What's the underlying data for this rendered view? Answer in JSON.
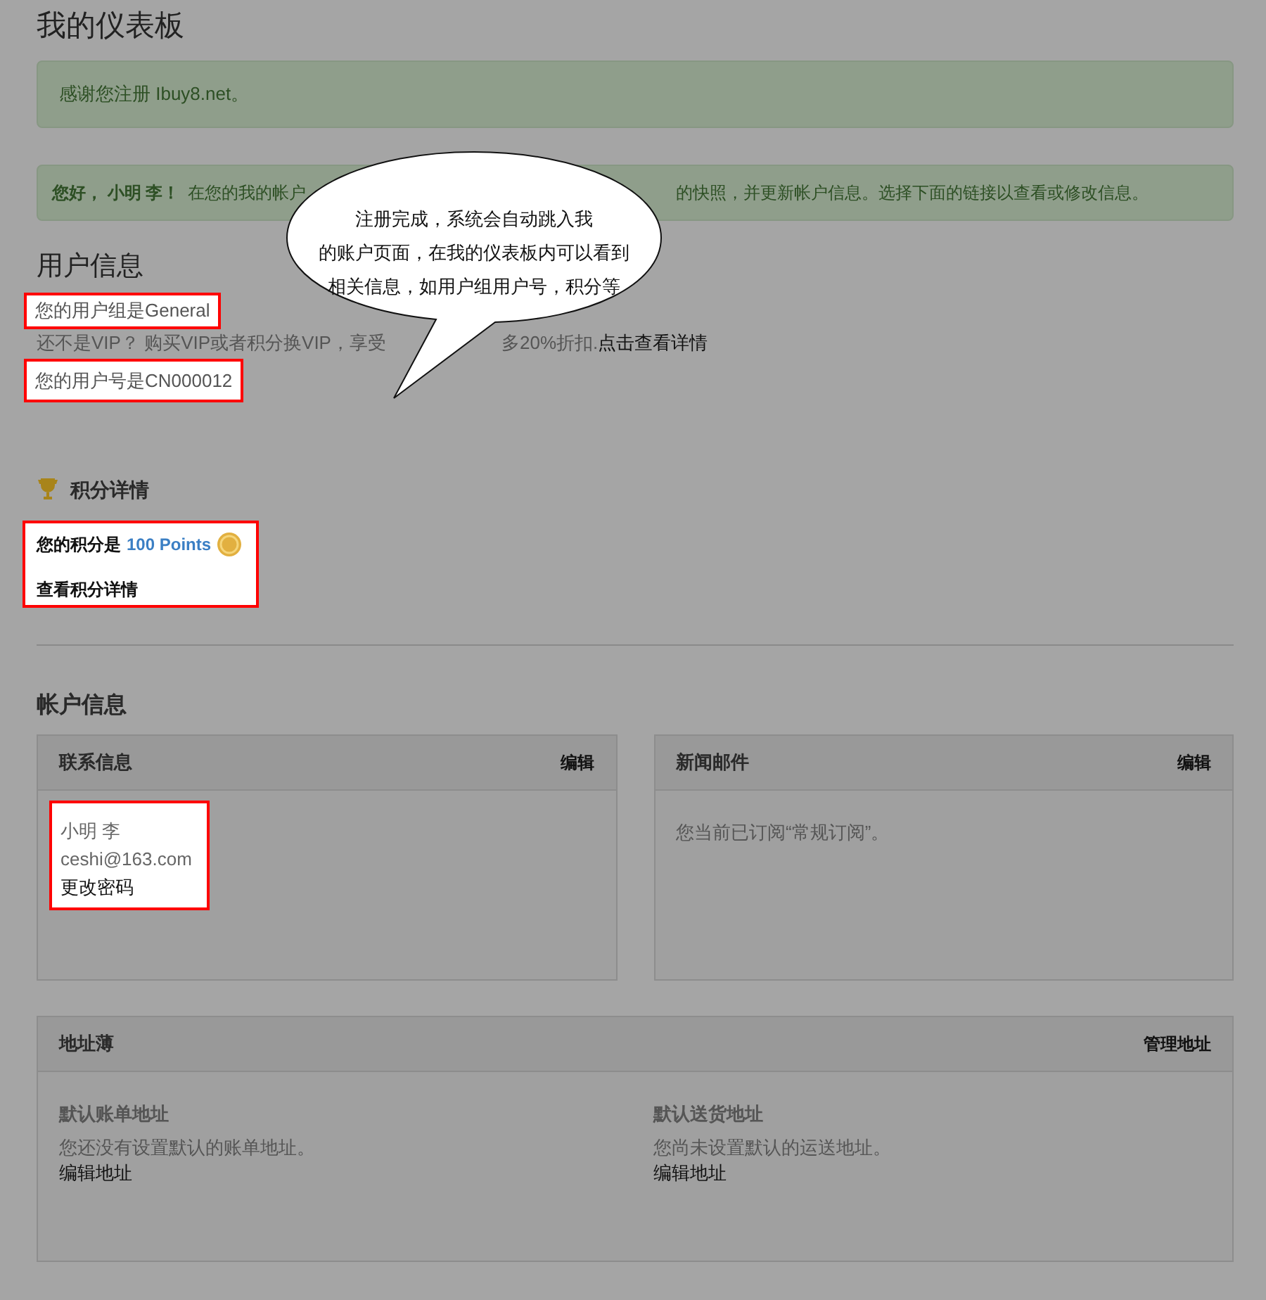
{
  "page_title": "我的仪表板",
  "notice": "感谢您注册 Ibuy8.net。",
  "welcome": {
    "greeting": "您好， 小明 李！",
    "text_before": "在您的我的帐户",
    "text_after": "的快照，并更新帐户信息。选择下面的链接以查看或修改信息。"
  },
  "callout": {
    "lines": [
      "注册完成，系统会自动跳入我",
      "的账户页面，在我的仪表板内可以看到",
      "相关信息，如用户组用户号，积分等"
    ]
  },
  "user_info": {
    "heading": "用户信息",
    "group": {
      "text": "您的用户组是General",
      "highlighted": true
    },
    "vip_before": "还不是VIP？ 购买VIP或者积分换VIP，享受",
    "vip_after": "多20%折扣.",
    "vip_link": "点击查看详情",
    "number": {
      "text": "您的用户号是CN000012",
      "highlighted": true
    }
  },
  "points": {
    "heading": "积分详情",
    "highlighted": true,
    "label": "您的积分是",
    "value": "100 Points",
    "link": "查看积分详情"
  },
  "account": {
    "heading": "帐户信息",
    "contact": {
      "title": "联系信息",
      "action": "编辑",
      "highlighted": true,
      "name": "小明 李",
      "email": "ceshi@163.com",
      "link": "更改密码"
    },
    "newsletter": {
      "title": "新闻邮件",
      "action": "编辑",
      "text": "您当前已订阅“常规订阅”。"
    },
    "address_book": {
      "title": "地址薄",
      "action": "管理地址",
      "columns": [
        {
          "title": "默认账单地址",
          "text": "您还没有设置默认的账单地址。",
          "link": "编辑地址"
        },
        {
          "title": "默认送货地址",
          "text": "您尚未设置默认的运送地址。",
          "link": "编辑地址"
        }
      ]
    }
  }
}
